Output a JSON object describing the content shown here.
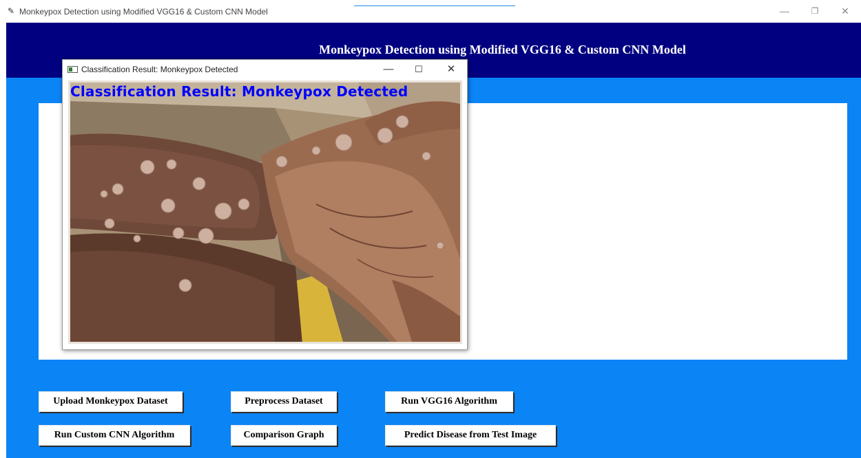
{
  "window": {
    "title": "Monkeypox Detection using Modified VGG16 & Custom CNN Model",
    "controls": {
      "minimize": "—",
      "maximize": "❐",
      "close": "✕"
    }
  },
  "app": {
    "heading": "Monkeypox Detection using Modified VGG16 & Custom CNN Model",
    "colors": {
      "body": "#0b84f5",
      "header": "#000080",
      "panel": "#ffffff"
    }
  },
  "popup": {
    "title": "Classification Result: Monkeypox Detected",
    "controls": {
      "minimize": "—",
      "maximize": "☐",
      "close": "✕"
    },
    "overlay_text": "Classification Result: Monkeypox Detected",
    "overlay_color": "#0000ff"
  },
  "buttons": {
    "upload": "Upload Monkeypox Dataset",
    "preprocess": "Preprocess Dataset",
    "run_vgg16": "Run VGG16 Algorithm",
    "run_cnn": "Run Custom CNN Algorithm",
    "comparison": "Comparison Graph",
    "predict": "Predict Disease from Test Image"
  }
}
